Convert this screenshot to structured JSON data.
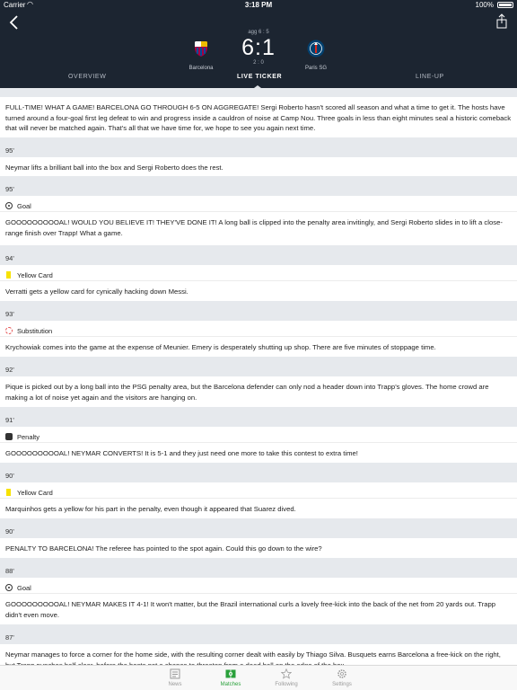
{
  "status_bar": {
    "carrier": "Carrier",
    "time": "3:18 PM",
    "battery": "100%"
  },
  "match": {
    "aggregate": "agg 6 : 5",
    "score": "6:1",
    "halftime": "2 : 0",
    "home_team": "Barcelona",
    "away_team": "Paris SG"
  },
  "tabs": [
    {
      "label": "OVERVIEW"
    },
    {
      "label": "LIVE TICKER"
    },
    {
      "label": "LINE-UP"
    }
  ],
  "ticker": {
    "intro": "FULL-TIME! WHAT A GAME! BARCELONA GO THROUGH 6-5 ON AGGREGATE! Sergi Roberto hasn't scored all season and what a time to get it. The hosts have turned around a four-goal first leg defeat to win and progress inside a cauldron of noise at Camp Nou. Three goals in less than eight minutes seal a historic comeback that will never be matched again. That's all that we have time for, we hope to see you again next time.",
    "entries": [
      {
        "minute": "95'",
        "event": "",
        "text": "Neymar lifts a brilliant ball into the box and Sergi Roberto does the rest."
      },
      {
        "minute": "95'",
        "event": "Goal",
        "text": "GOOOOOOOOOAL! WOULD YOU BELIEVE IT! THEY'VE DONE IT! A long ball is clipped into the penalty area invitingly, and Sergi Roberto slides in to lift a close-range finish over Trapp! What a game."
      },
      {
        "minute": "94'",
        "event": "Yellow Card",
        "text": "Verratti gets a yellow card for cynically hacking down Messi."
      },
      {
        "minute": "93'",
        "event": "Substitution",
        "text": "Krychowiak comes into the game at the expense of Meunier. Emery is desperately shutting up shop. There are five minutes of stoppage time."
      },
      {
        "minute": "92'",
        "event": "",
        "text": "Pique is picked out by a long ball into the PSG penalty area, but the Barcelona defender can only nod a header down into Trapp's gloves. The home crowd are making a lot of noise yet again and the visitors are hanging on."
      },
      {
        "minute": "91'",
        "event": "Penalty",
        "text": "GOOOOOOOOOAL! NEYMAR CONVERTS! It is 5-1 and they just need one more to take this contest to extra time!"
      },
      {
        "minute": "90'",
        "event": "Yellow Card",
        "text": "Marquinhos gets a yellow for his part in the penalty, even though it appeared that Suarez dived."
      },
      {
        "minute": "90'",
        "event": "",
        "text": "PENALTY TO BARCELONA! The referee has pointed to the spot again. Could this go down to the wire?"
      },
      {
        "minute": "88'",
        "event": "Goal",
        "text": "GOOOOOOOOOAL! NEYMAR MAKES IT 4-1! It won't matter, but the Brazil international curls a lovely free-kick into the back of the net from 20 yards out. Trapp didn't even move."
      },
      {
        "minute": "87'",
        "event": "",
        "text": "Neymar manages to force a corner for the home side, with the resulting corner dealt with easily by Thiago Silva. Busquets earns Barcelona a free-kick on the right, but Trapp punches half-clear, before the hosts get a chance to threaten from a dead ball on the edge of the box."
      }
    ]
  },
  "tabbar": [
    {
      "label": "News",
      "icon": "news-icon"
    },
    {
      "label": "Matches",
      "icon": "matches-icon"
    },
    {
      "label": "Following",
      "icon": "star-icon"
    },
    {
      "label": "Settings",
      "icon": "gear-icon"
    }
  ],
  "colors": {
    "header_bg": "#1c2531",
    "accent": "#2aa13b",
    "yellow_card": "#f7e200",
    "separator": "#e6e9ed"
  }
}
